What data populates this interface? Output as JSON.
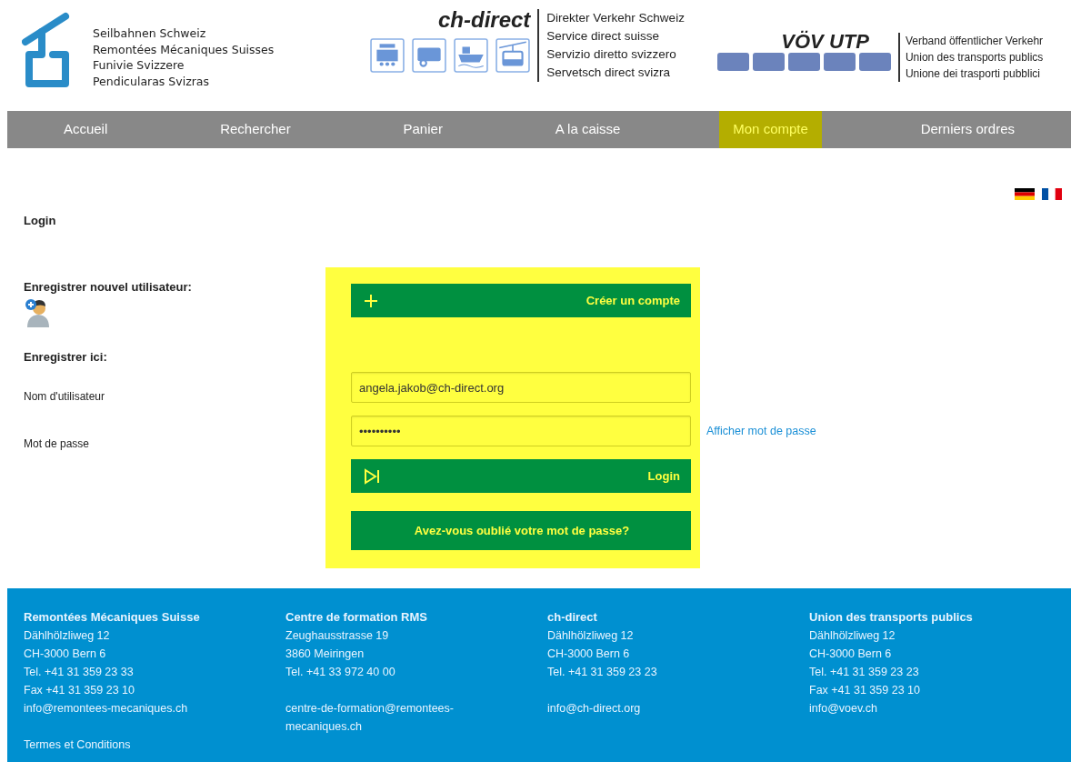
{
  "header": {
    "rms_logo": {
      "lines": [
        "Seilbahnen Schweiz",
        "Remontées Mécaniques Suisses",
        "Funivie Svizzere",
        "Pendicularas Svizras"
      ]
    },
    "chdirect_logo": {
      "title": "ch-direct",
      "lines": [
        "Direkter Verkehr Schweiz",
        "Service direct suisse",
        "Servizio diretto svizzero",
        "Servetsch direct svizra"
      ]
    },
    "voev_logo": {
      "title": "VÖV UTP",
      "lines": [
        "Verband öffentlicher Verkehr",
        "Union des transports publics",
        "Unione dei trasporti pubblici"
      ]
    }
  },
  "nav": [
    {
      "label": "Accueil",
      "selected": false
    },
    {
      "label": "Rechercher",
      "selected": false
    },
    {
      "label": "Panier",
      "selected": false
    },
    {
      "label": "A la caisse",
      "selected": false
    },
    {
      "label": "Mon compte",
      "selected": true
    },
    {
      "label": "Derniers ordres",
      "selected": false
    }
  ],
  "languages": [
    {
      "kind": "de"
    },
    {
      "kind": "fr"
    }
  ],
  "login": {
    "title": "Login",
    "register_heading": "Enregistrer nouvel utilisateur:",
    "create_button": "Créer un compte",
    "register_here": "Enregistrer ici:",
    "username": {
      "label": "Nom d'utilisateur",
      "value": "angela.jakob@ch-direct.org"
    },
    "password": {
      "label": "Mot de passe",
      "value": "••••••••••",
      "show_link": "Afficher mot de passe"
    },
    "login_button": "Login",
    "forgot_button": "Avez-vous oublié votre mot de passe?"
  },
  "footer": [
    {
      "title": "Remontées Mécaniques Suisse",
      "blocks": [
        [
          "Dählhölzliweg 12",
          "CH-3000 Bern 6",
          "Tel. +41 31 359 23 33",
          "Fax +41 31 359 23 10",
          "info@remontees-mecaniques.ch"
        ],
        [
          "Termes et Conditions"
        ]
      ]
    },
    {
      "title": "Centre de formation RMS",
      "blocks": [
        [
          "Zeughausstrasse 19",
          "3860 Meiringen",
          "Tel. +41 33 972 40 00"
        ],
        [
          "centre-de-formation@remontees-mecaniques.ch"
        ]
      ]
    },
    {
      "title": "ch-direct",
      "blocks": [
        [
          "Dählhölzliweg 12",
          "CH-3000 Bern 6",
          "Tel. +41 31 359 23 23"
        ],
        [
          "info@ch-direct.org"
        ]
      ]
    },
    {
      "title": "Union des transports publics",
      "blocks": [
        [
          "Dählhölzliweg 12",
          "CH-3000 Bern 6",
          "Tel. +41 31 359 23 23",
          "Fax +41 31 359 23 10",
          "info@voev.ch"
        ]
      ]
    }
  ]
}
